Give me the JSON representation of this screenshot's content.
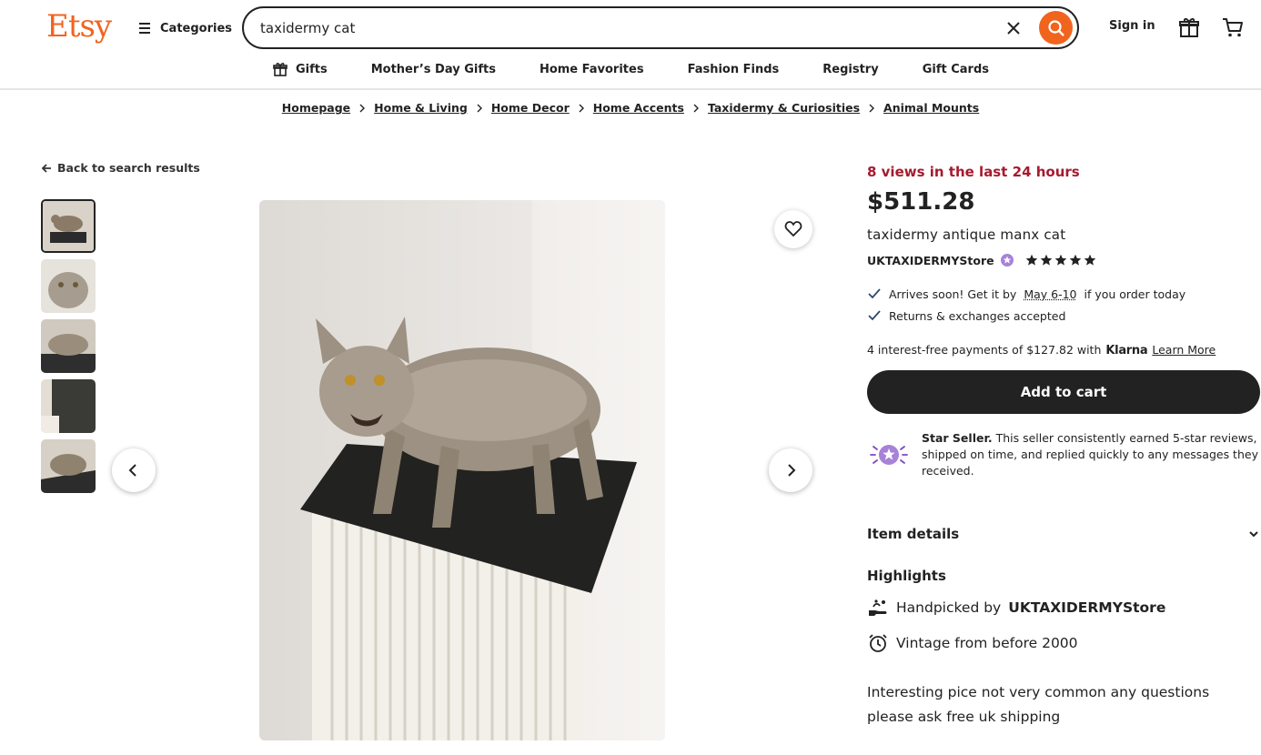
{
  "header": {
    "logo": "Etsy",
    "categories_label": "Categories",
    "search_value": "taxidermy cat",
    "sign_in": "Sign in"
  },
  "nav": {
    "items": [
      "Gifts",
      "Mother’s Day Gifts",
      "Home Favorites",
      "Fashion Finds",
      "Registry",
      "Gift Cards"
    ]
  },
  "breadcrumb": [
    "Homepage",
    "Home & Living",
    "Home Decor",
    "Home Accents",
    "Taxidermy & Curiosities",
    "Animal Mounts"
  ],
  "gallery": {
    "back_label": "Back to search results",
    "thumbnail_count": 5
  },
  "listing": {
    "views_note": "8 views in the last 24 hours",
    "price": "$511.28",
    "title": "taxidermy antique manx cat",
    "shop_name": "UKTAXIDERMYStore",
    "rating_stars": 5,
    "arrival_prefix": "Arrives soon! Get it by",
    "arrival_date": "May 6-10",
    "arrival_suffix": "if you order today",
    "returns": "Returns & exchanges accepted",
    "klarna_text": "4 interest-free payments of $127.82 with",
    "klarna_brand": "Klarna",
    "klarna_link": "Learn More",
    "add_to_cart": "Add to cart",
    "star_seller_title": "Star Seller.",
    "star_seller_text": "This seller consistently earned 5-star reviews, shipped on time, and replied quickly to any messages they received.",
    "item_details": "Item details",
    "highlights_title": "Highlights",
    "handpicked_prefix": "Handpicked by",
    "handpicked_shop": "UKTAXIDERMYStore",
    "vintage": "Vintage from before 2000",
    "description": "Interesting pice not very common any questions please ask free uk shipping"
  },
  "colors": {
    "brand": "#f1641e",
    "views": "#a61a2e",
    "star_seller": "#7f46c2",
    "check": "#2f466c"
  }
}
